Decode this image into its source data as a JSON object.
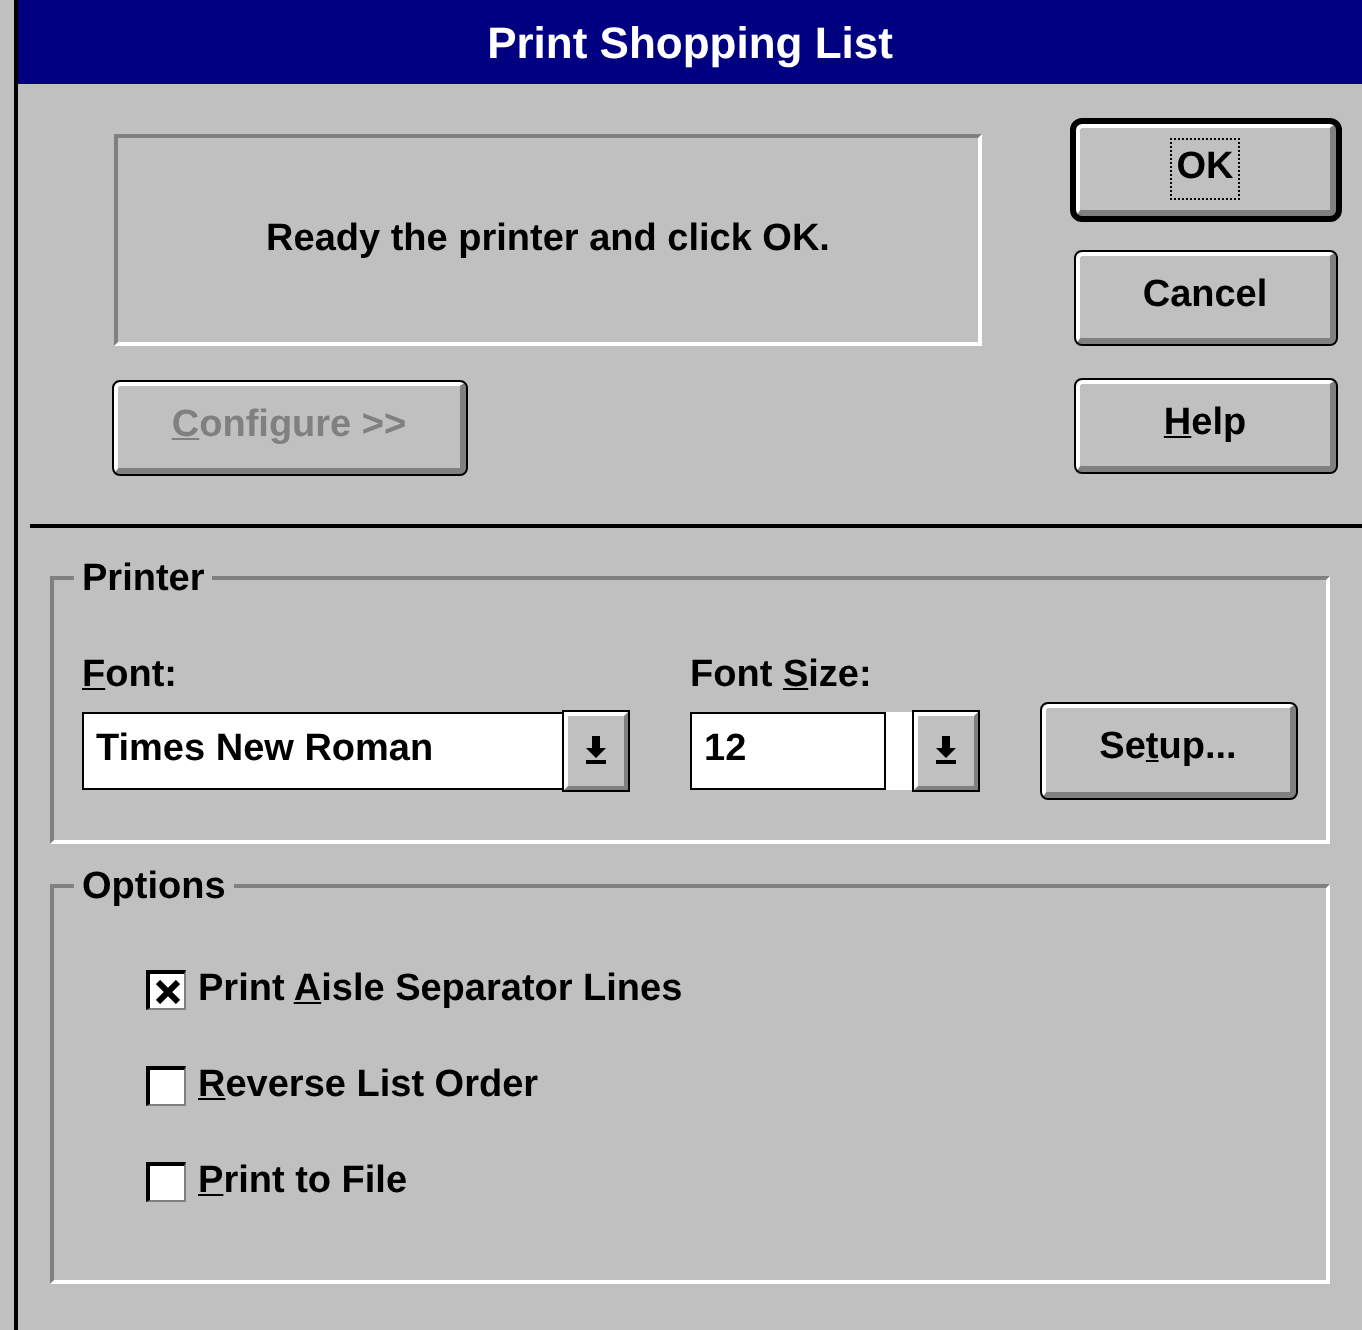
{
  "window": {
    "title": "Print Shopping List"
  },
  "message": "Ready the printer and click OK.",
  "configure_button": {
    "key": "C",
    "post": "onfigure >>",
    "disabled": true
  },
  "buttons": [
    {
      "pre": "OK",
      "default": true
    },
    {
      "pre": "Cancel",
      "default": false
    },
    {
      "key": "H",
      "post": "elp",
      "default": false
    }
  ],
  "printer": {
    "title": "Printer",
    "font_label": {
      "key": "F",
      "post": "ont:"
    },
    "font_value": "Times New Roman",
    "size_label": {
      "pre": "Font ",
      "key": "S",
      "post": "ize:"
    },
    "size_value": "12",
    "setup_button": {
      "pre": "Se",
      "key": "t",
      "post": "up..."
    }
  },
  "options": {
    "title": "Options",
    "items": [
      {
        "pre": "Print ",
        "key": "A",
        "post": "isle Separator Lines",
        "checked": true
      },
      {
        "key": "R",
        "post": "everse List Order",
        "checked": false
      },
      {
        "key": "P",
        "post": "rint to File",
        "checked": false
      }
    ]
  }
}
